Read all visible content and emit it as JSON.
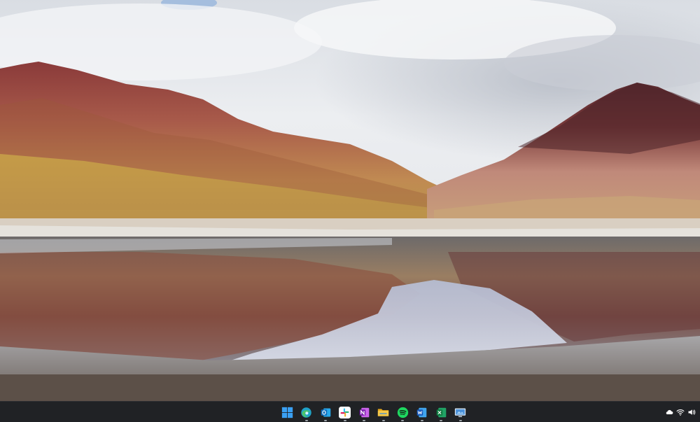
{
  "desktop": {
    "wallpaper_icon": "landscape-wallpaper"
  },
  "taskbar": {
    "background": "#202225",
    "apps": [
      {
        "name": "start",
        "icon": "windows-logo-icon",
        "color": "#3aa0f3",
        "running": false
      },
      {
        "name": "edge",
        "icon": "edge-icon",
        "color": "#1fa2c8",
        "running": true
      },
      {
        "name": "outlook",
        "icon": "outlook-icon",
        "color": "#0f6cbd",
        "running": true
      },
      {
        "name": "slack",
        "icon": "slack-icon",
        "color": "#e01e5a",
        "running": true
      },
      {
        "name": "onenote",
        "icon": "onenote-icon",
        "color": "#7719aa",
        "running": true
      },
      {
        "name": "file-explorer",
        "icon": "folder-icon",
        "color": "#f7c948",
        "running": true
      },
      {
        "name": "spotify",
        "icon": "spotify-icon",
        "color": "#1ed760",
        "running": true
      },
      {
        "name": "word",
        "icon": "word-icon",
        "color": "#185abd",
        "running": true
      },
      {
        "name": "excel",
        "icon": "excel-icon",
        "color": "#107c41",
        "running": true
      },
      {
        "name": "remote-desktop",
        "icon": "remote-desktop-icon",
        "color": "#4a90d9",
        "running": true
      }
    ],
    "tray": [
      {
        "name": "cloud",
        "icon": "cloud-icon"
      },
      {
        "name": "wifi",
        "icon": "wifi-icon"
      },
      {
        "name": "volume",
        "icon": "volume-icon"
      }
    ]
  }
}
